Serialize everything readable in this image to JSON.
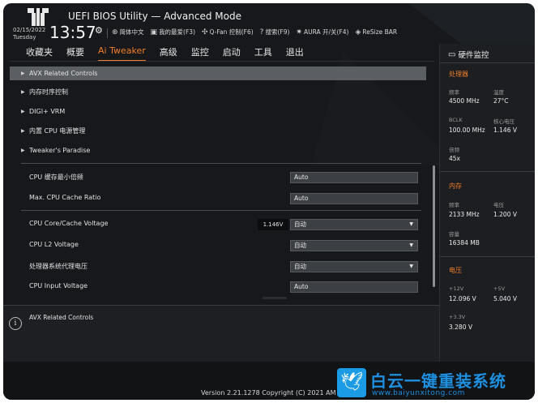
{
  "header": {
    "title": "UEFI BIOS Utility — Advanced Mode",
    "date": "02/15/2022",
    "day": "Tuesday",
    "time": "13:57",
    "toolbar": [
      {
        "icon": "globe-icon",
        "glyph": "⊕",
        "label": "简体中文"
      },
      {
        "icon": "favorites-icon",
        "glyph": "▣",
        "label": "我的最爱(F3)"
      },
      {
        "icon": "fan-icon",
        "glyph": "✣",
        "label": "Q-Fan 控制(F6)"
      },
      {
        "icon": "search-icon",
        "glyph": "?",
        "label": "搜索(F9)"
      },
      {
        "icon": "aura-icon",
        "glyph": "✷",
        "label": "AURA 开/关(F4)"
      },
      {
        "icon": "resize-bar-icon",
        "glyph": "◈",
        "label": "ReSize BAR"
      }
    ]
  },
  "nav": {
    "tabs": [
      "收藏夹",
      "概要",
      "Ai Tweaker",
      "高级",
      "监控",
      "启动",
      "工具",
      "退出"
    ],
    "active_index": 2
  },
  "menu": {
    "items": [
      "AVX Related Controls",
      "内存时序控制",
      "DIGI+ VRM",
      "内置 CPU 电源管理",
      "Tweaker's Paradise"
    ]
  },
  "settings": [
    {
      "label": "CPU 缓存最小倍频",
      "value": "Auto",
      "dropdown": false,
      "voltage": ""
    },
    {
      "label": "Max. CPU Cache Ratio",
      "value": "Auto",
      "dropdown": false,
      "voltage": ""
    },
    {
      "label": "CPU Core/Cache Voltage",
      "value": "自动",
      "dropdown": true,
      "voltage": "1.146V"
    },
    {
      "label": "CPU L2 Voltage",
      "value": "自动",
      "dropdown": true,
      "voltage": ""
    },
    {
      "label": "处理器系统代理电压",
      "value": "自动",
      "dropdown": true,
      "voltage": ""
    },
    {
      "label": "CPU Input Voltage",
      "value": "Auto",
      "dropdown": false,
      "voltage": ""
    }
  ],
  "help": {
    "text": "AVX Related Controls"
  },
  "monitor": {
    "title": "硬件监控",
    "processor": {
      "heading": "处理器",
      "freq_label": "频率",
      "freq_value": "4500 MHz",
      "temp_label": "温度",
      "temp_value": "27°C",
      "bclk_label": "BCLK",
      "bclk_value": "100.00 MHz",
      "core_v_label": "核心电压",
      "core_v_value": "1.146 V",
      "ratio_label": "倍频",
      "ratio_value": "45x"
    },
    "memory": {
      "heading": "内存",
      "freq_label": "频率",
      "freq_value": "2133 MHz",
      "volt_label": "电压",
      "volt_value": "1.200 V",
      "cap_label": "容量",
      "cap_value": "16384 MB"
    },
    "voltage": {
      "heading": "电压",
      "v12_label": "+12V",
      "v12_value": "12.096 V",
      "v5_label": "+5V",
      "v5_value": "5.040 V",
      "v33_label": "+3.3V",
      "v33_value": "3.280 V"
    }
  },
  "footer": {
    "copyright": "Version 2.21.1278 Copyright (C) 2021 AM"
  },
  "watermark": {
    "brand": "白云一键重装系统",
    "url": "www.baiyunxitong.com"
  },
  "colors": {
    "accent": "#f07d2b",
    "background": "#16181b",
    "selected_row": "#5b5e62",
    "watermark": "#1f8fe0"
  }
}
